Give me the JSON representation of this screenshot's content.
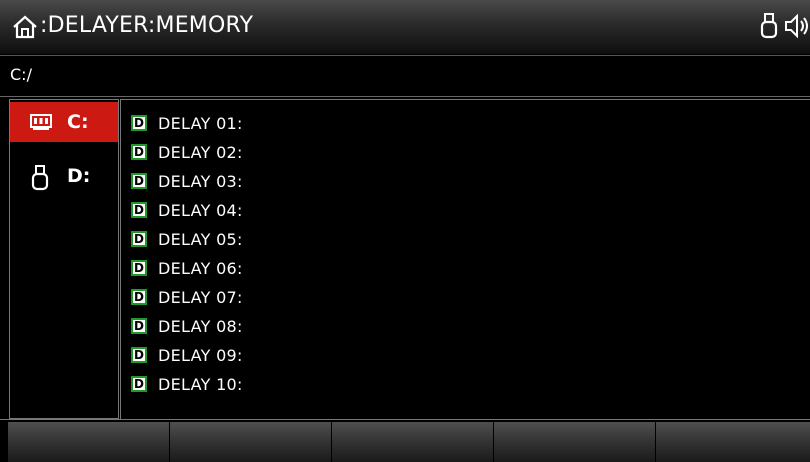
{
  "title": {
    "text": ":DELAYER:MEMORY",
    "home_icon": "home-icon",
    "status_icons": [
      "usb-drive-icon",
      "speaker-icon"
    ]
  },
  "path": {
    "text": "C:/"
  },
  "drives": [
    {
      "label": "C:",
      "icon": "internal-memory-icon",
      "selected": true
    },
    {
      "label": "D:",
      "icon": "usb-drive-icon",
      "selected": false
    }
  ],
  "files": [
    {
      "label": "DELAY 01:",
      "icon_letter": "D"
    },
    {
      "label": "DELAY 02:",
      "icon_letter": "D"
    },
    {
      "label": "DELAY 03:",
      "icon_letter": "D"
    },
    {
      "label": "DELAY 04:",
      "icon_letter": "D"
    },
    {
      "label": "DELAY 05:",
      "icon_letter": "D"
    },
    {
      "label": "DELAY 06:",
      "icon_letter": "D"
    },
    {
      "label": "DELAY 07:",
      "icon_letter": "D"
    },
    {
      "label": "DELAY 08:",
      "icon_letter": "D"
    },
    {
      "label": "DELAY 09:",
      "icon_letter": "D"
    },
    {
      "label": "DELAY 10:",
      "icon_letter": "D"
    }
  ],
  "softkeys": [
    "",
    "",
    "",
    "",
    ""
  ],
  "colors": {
    "accent": "#cc1a12",
    "file_icon_border": "#1f9a2a"
  }
}
